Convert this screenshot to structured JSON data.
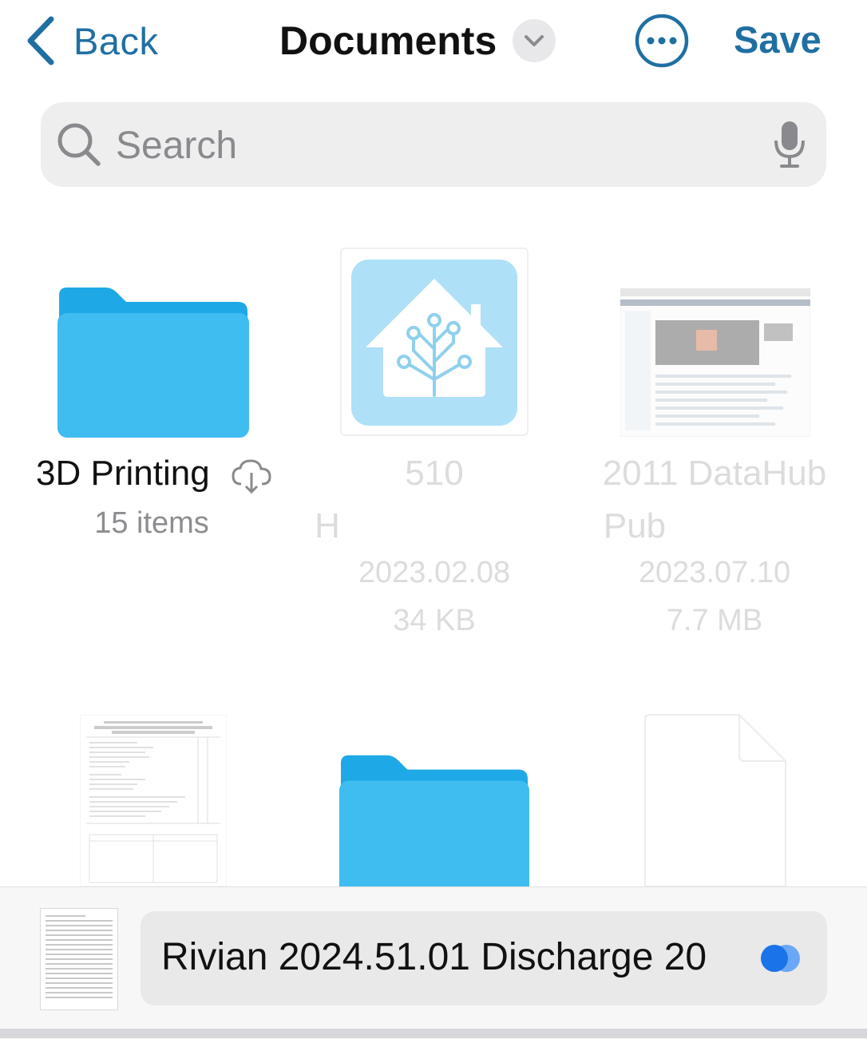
{
  "nav": {
    "back_label": "Back",
    "title": "Documents",
    "save_label": "Save"
  },
  "search": {
    "placeholder": "Search"
  },
  "items": [
    {
      "name": "3D Printing",
      "meta": "15 items",
      "icon": "folder-icon",
      "status_icon": "cloud-download-icon"
    },
    {
      "name_line1": "510",
      "name_line2": "H",
      "date": "2023.02.08",
      "size": "34 KB",
      "icon": "home-assistant-thumbnail"
    },
    {
      "name_line1": "2011 DataHub",
      "name_line2": "Pub",
      "date": "2023.07.10",
      "size": "7.7 MB",
      "icon": "datahub-screenshot-thumbnail"
    },
    {
      "icon": "order-form-thumbnail"
    },
    {
      "icon": "folder-icon"
    },
    {
      "icon": "blank-document-icon"
    }
  ],
  "bottom": {
    "filename": "Rivian 2024.51.01 Discharge 20"
  },
  "colors": {
    "accent": "#1f6fa3",
    "folder": "#3fb8ee",
    "toggle": "#1a73e8"
  }
}
